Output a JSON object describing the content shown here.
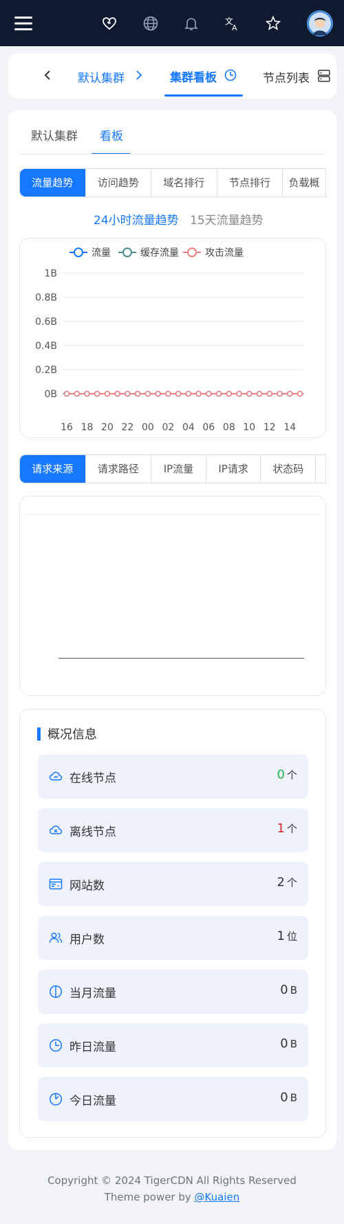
{
  "breadcrumb": {
    "item1": "默认集群",
    "item2": "集群看板",
    "item3": "节点列表"
  },
  "top_tabs": [
    "默认集群",
    "看板"
  ],
  "chart_tabs": [
    "流量趋势",
    "访问趋势",
    "域名排行",
    "节点排行",
    "负载概"
  ],
  "period": {
    "active": "24小时流量趋势",
    "other": "15天流量趋势"
  },
  "chart_data": {
    "type": "line",
    "legend": [
      "流量",
      "缓存流量",
      "攻击流量"
    ],
    "y_ticks": [
      "1B",
      "0.8B",
      "0.6B",
      "0.4B",
      "0.2B",
      "0B"
    ],
    "ylim": [
      0,
      1
    ],
    "x_ticks": [
      "16",
      "18",
      "20",
      "22",
      "00",
      "02",
      "04",
      "06",
      "08",
      "10",
      "12",
      "14"
    ],
    "x": [
      "16",
      "17",
      "18",
      "19",
      "20",
      "21",
      "22",
      "23",
      "00",
      "01",
      "02",
      "03",
      "04",
      "05",
      "06",
      "07",
      "08",
      "09",
      "10",
      "11",
      "12",
      "13",
      "14",
      "15"
    ],
    "series": [
      {
        "name": "流量",
        "color": "#1677ff",
        "values": [
          0,
          0,
          0,
          0,
          0,
          0,
          0,
          0,
          0,
          0,
          0,
          0,
          0,
          0,
          0,
          0,
          0,
          0,
          0,
          0,
          0,
          0,
          0,
          0
        ]
      },
      {
        "name": "缓存流量",
        "color": "#4e8d8f",
        "values": [
          0,
          0,
          0,
          0,
          0,
          0,
          0,
          0,
          0,
          0,
          0,
          0,
          0,
          0,
          0,
          0,
          0,
          0,
          0,
          0,
          0,
          0,
          0,
          0
        ]
      },
      {
        "name": "攻击流量",
        "color": "#f08080",
        "values": [
          0,
          0,
          0,
          0,
          0,
          0,
          0,
          0,
          0,
          0,
          0,
          0,
          0,
          0,
          0,
          0,
          0,
          0,
          0,
          0,
          0,
          0,
          0,
          0
        ]
      }
    ]
  },
  "request_tabs": [
    "请求来源",
    "请求路径",
    "IP流量",
    "IP请求",
    "状态码"
  ],
  "overview": {
    "title": "概况信息",
    "rows": [
      {
        "label": "在线节点",
        "value": "0",
        "unit": "个",
        "color": "#22b14c",
        "icon": "cloud-icon"
      },
      {
        "label": "离线节点",
        "value": "1",
        "unit": "个",
        "color": "#e02424",
        "icon": "cloud-off-icon"
      },
      {
        "label": "网站数",
        "value": "2",
        "unit": "个",
        "color": "#333333",
        "icon": "website-icon"
      },
      {
        "label": "用户数",
        "value": "1",
        "unit": "位",
        "color": "#333333",
        "icon": "users-icon"
      },
      {
        "label": "当月流量",
        "value": "0",
        "unit": "B",
        "color": "#333333",
        "icon": "half-circle-icon"
      },
      {
        "label": "昨日流量",
        "value": "0",
        "unit": "B",
        "color": "#333333",
        "icon": "clock-icon"
      },
      {
        "label": "今日流量",
        "value": "0",
        "unit": "B",
        "color": "#333333",
        "icon": "today-icon"
      }
    ]
  },
  "footer": {
    "copyright": "Copyright © 2024 TigerCDN All Rights Reserved",
    "theme_prefix": "Theme power by ",
    "theme_link": "@Kuaien"
  },
  "colors": {
    "accent": "#1677ff",
    "topbar": "#0f1a30"
  }
}
